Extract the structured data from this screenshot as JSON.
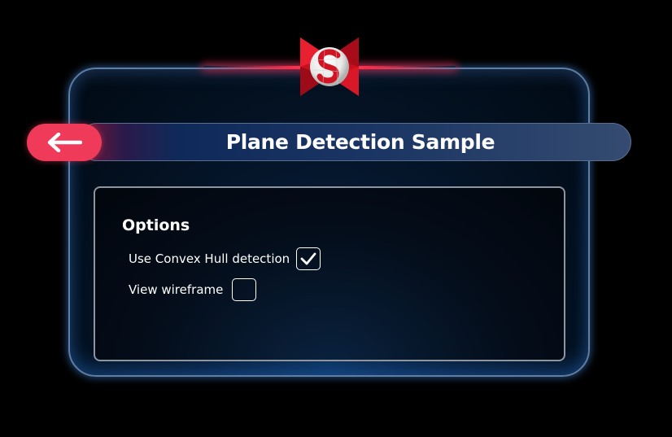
{
  "header": {
    "title": "Plane Detection Sample",
    "back_icon": "arrow-left-icon",
    "logo_icon": "snapdragon-logo-icon"
  },
  "options": {
    "heading": "Options",
    "items": [
      {
        "label": "Use Convex Hull detection",
        "checked": true
      },
      {
        "label": "View wireframe",
        "checked": false
      }
    ]
  },
  "colors": {
    "accent": "#ef3a5a",
    "panel_border": "#5f7ea3",
    "glow_blue": "#3a8be0",
    "glow_red": "#ff2a46"
  }
}
